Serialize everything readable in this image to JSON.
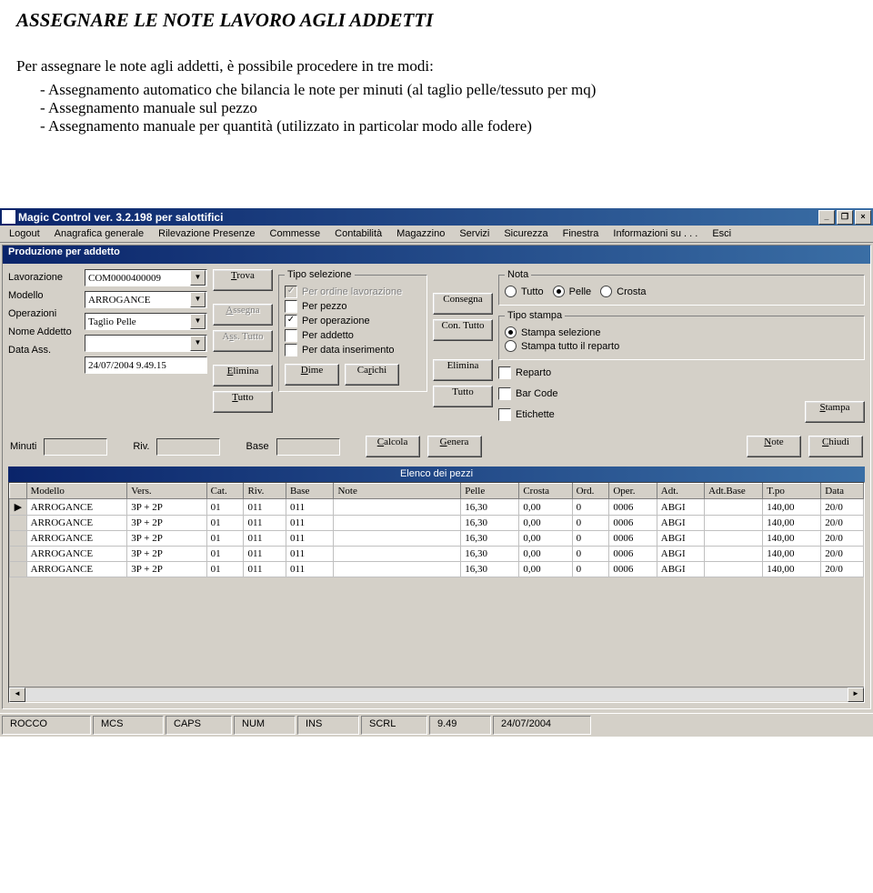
{
  "doc": {
    "title": "ASSEGNARE LE NOTE LAVORO AGLI ADDETTI",
    "intro": "Per assegnare le note agli addetti, è possibile procedere in tre modi:",
    "items": [
      "Assegnamento automatico che bilancia le note per minuti (al taglio pelle/tessuto per mq)",
      "Assegnamento manuale sul pezzo",
      "Assegnamento manuale per quantità (utilizzato in particolar modo alle fodere)"
    ]
  },
  "app": {
    "title": "Magic Control ver. 3.2.198 per salottifici",
    "menu": [
      "Logout",
      "Anagrafica generale",
      "Rilevazione Presenze",
      "Commesse",
      "Contabilità",
      "Magazzino",
      "Servizi",
      "Sicurezza",
      "Finestra",
      "Informazioni su . . .",
      "Esci"
    ],
    "form_title": "Produzione per addetto",
    "labels": {
      "lavorazione": "Lavorazione",
      "modello": "Modello",
      "operazioni": "Operazioni",
      "nome_addetto": "Nome Addetto",
      "data_ass": "Data Ass.",
      "minuti": "Minuti",
      "riv": "Riv.",
      "base": "Base"
    },
    "values": {
      "lavorazione": "COM0000400009",
      "modello": "ARROGANCE",
      "operazioni": "Taglio Pelle",
      "nome_addetto": "",
      "data_ass": "24/07/2004 9.49.15",
      "minuti": "",
      "riv": "",
      "base": ""
    },
    "buttons": {
      "trova": "Trova",
      "assegna": "Assegna",
      "ass_tutto": "Ass. Tutto",
      "elimina": "Elimina",
      "tutto": "Tutto",
      "dime": "Dime",
      "carichi": "Carichi",
      "consegna": "Consegna",
      "con_tutto": "Con. Tutto",
      "elimina2": "Elimina",
      "tutto2": "Tutto",
      "calcola": "Calcola",
      "genera": "Genera",
      "note": "Note",
      "stampa": "Stampa",
      "chiudi": "Chiudi"
    },
    "tipo_selezione": {
      "legend": "Tipo selezione",
      "opts": [
        {
          "label": "Per ordine lavorazione",
          "checked": true,
          "disabled": true
        },
        {
          "label": "Per pezzo",
          "checked": false,
          "disabled": false
        },
        {
          "label": "Per operazione",
          "checked": true,
          "disabled": false
        },
        {
          "label": "Per addetto",
          "checked": false,
          "disabled": false
        },
        {
          "label": "Per data inserimento",
          "checked": false,
          "disabled": false
        }
      ]
    },
    "nota": {
      "legend": "Nota",
      "opts": [
        "Tutto",
        "Pelle",
        "Crosta"
      ],
      "selected": 1
    },
    "tipo_stampa": {
      "legend": "Tipo stampa",
      "opts": [
        "Stampa selezione",
        "Stampa tutto il reparto"
      ],
      "selected": 0
    },
    "stampa_chk": [
      {
        "label": "Reparto",
        "checked": false
      },
      {
        "label": "Bar Code",
        "checked": false
      },
      {
        "label": "Etichette",
        "checked": false
      }
    ],
    "table": {
      "title": "Elenco dei pezzi",
      "cols": [
        "",
        "Modello",
        "Vers.",
        "Cat.",
        "Riv.",
        "Base",
        "Note",
        "Pelle",
        "Crosta",
        "Ord.",
        "Oper.",
        "Adt.",
        "Adt.Base",
        "T.po",
        "Data"
      ],
      "rows": [
        [
          "▶",
          "ARROGANCE",
          "3P + 2P",
          "01",
          "011",
          "011",
          "",
          "16,30",
          "0,00",
          "0",
          "0006",
          "ABGI",
          "",
          "140,00",
          "20/0"
        ],
        [
          "",
          "ARROGANCE",
          "3P + 2P",
          "01",
          "011",
          "011",
          "",
          "16,30",
          "0,00",
          "0",
          "0006",
          "ABGI",
          "",
          "140,00",
          "20/0"
        ],
        [
          "",
          "ARROGANCE",
          "3P + 2P",
          "01",
          "011",
          "011",
          "",
          "16,30",
          "0,00",
          "0",
          "0006",
          "ABGI",
          "",
          "140,00",
          "20/0"
        ],
        [
          "",
          "ARROGANCE",
          "3P + 2P",
          "01",
          "011",
          "011",
          "",
          "16,30",
          "0,00",
          "0",
          "0006",
          "ABGI",
          "",
          "140,00",
          "20/0"
        ],
        [
          "",
          "ARROGANCE",
          "3P + 2P",
          "01",
          "011",
          "011",
          "",
          "16,30",
          "0,00",
          "0",
          "0006",
          "ABGI",
          "",
          "140,00",
          "20/0"
        ]
      ]
    },
    "status": [
      "ROCCO",
      "MCS",
      "CAPS",
      "NUM",
      "INS",
      "SCRL",
      "9.49",
      "24/07/2004"
    ]
  }
}
